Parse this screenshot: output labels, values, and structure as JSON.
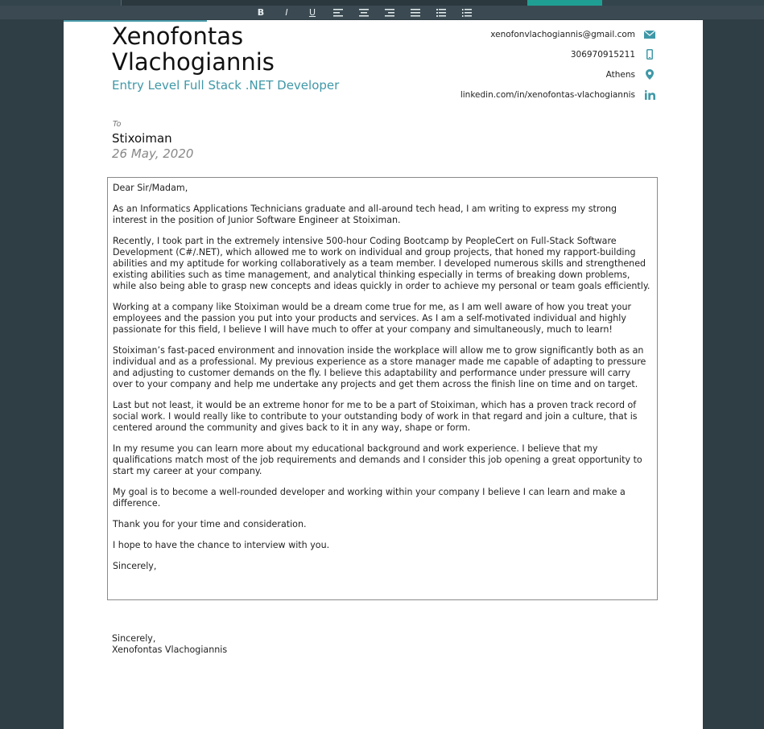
{
  "toolbar": {
    "buttons": [
      {
        "name": "bold-button",
        "label": "B"
      },
      {
        "name": "italic-button",
        "label": "I"
      },
      {
        "name": "underline-button",
        "label": "U"
      }
    ]
  },
  "header": {
    "name": "Xenofontas Vlachogiannis",
    "headline": "Entry Level Full Stack .NET Developer"
  },
  "contacts": {
    "email": "xenofonvlachogiannis@gmail.com",
    "phone": "306970915211",
    "city": "Athens",
    "linkedin": "linkedin.com/in/xenofontas-vlachogiannis"
  },
  "recipient": {
    "to_label": "To",
    "company": "Stixoiman",
    "date": "26 May, 2020"
  },
  "letter": {
    "paragraphs": [
      "Dear Sir/Madam,",
      "As an Informatics Applications Technicians graduate and all-around tech head, I am writing to express my strong interest in the position of Junior Software Engineer at Stoiximan.",
      "Recently, I took part in the extremely intensive 500-hour Coding Bootcamp by PeopleCert on Full-Stack Software Development (C#/.NET), which allowed me to work on individual and group projects, that honed my rapport-building abilities and my aptitude for working collaboratively as a team member. I developed numerous skills and strengthened existing abilities such as time management, and analytical thinking especially in terms of breaking down problems, while also being able to grasp new concepts and ideas quickly in order to achieve my personal or team goals efficiently.",
      "Working at a company like Stoiximan would be a dream come true for me, as I am well aware of how you treat your employees and the passion you put into your products and services. As I am a self-motivated individual and highly passionate for this field, I believe I will have much to offer at your company and simultaneously, much to learn!",
      "Stoiximan’s fast-paced environment and innovation inside the workplace will allow me to grow significantly both as an individual and as a professional. My previous experience as a store manager made me capable of adapting to pressure and adjusting to customer demands on the fly. I believe this adaptability and performance under pressure will carry over to your company and help me undertake any projects and get them across the finish line on time and on target.",
      "Last but not least, it would be an extreme honor for me to be a part of Stoiximan, which has a proven track record of social work. I would really like to contribute to your outstanding body of work in that regard and join a culture, that is centered around the community and gives back to it in any way, shape or form.",
      "In my resume you can learn more about my educational background and work experience. I believe that my qualifications match most of the job requirements and demands and I consider this job opening a great opportunity to start my career at your company.",
      "My goal is to become a well-rounded developer and working within your company I believe I can learn and make a difference.",
      "Thank you for your time and consideration.",
      "I hope to have the chance to interview with you.",
      "Sincerely,"
    ]
  },
  "closing": {
    "salutation": "Sincerely,",
    "signature": "Xenofontas Vlachogiannis"
  },
  "colors": {
    "accent": "#3f98a7",
    "toolbar_bg": "#3b4a52",
    "workspace_bg": "#2f3d44"
  }
}
